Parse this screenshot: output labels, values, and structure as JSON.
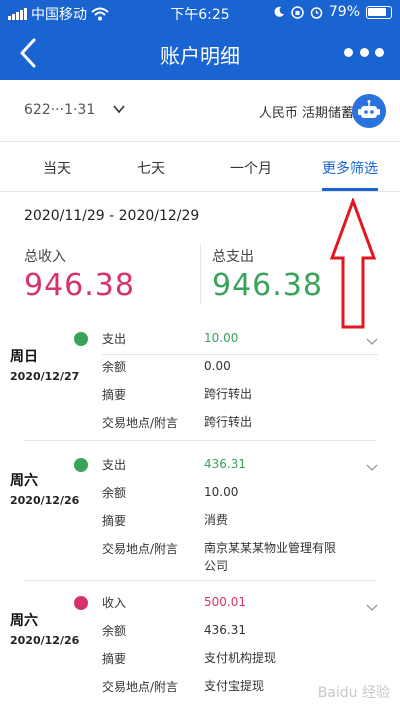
{
  "status": {
    "carrier": "中国移动",
    "time": "下午6:25",
    "battery": "79%"
  },
  "nav": {
    "title": "账户明细"
  },
  "account": {
    "number": "622···1·31",
    "currency": "人民币 活期储蓄"
  },
  "tabs": [
    {
      "label": "当天"
    },
    {
      "label": "七天"
    },
    {
      "label": "一个月"
    },
    {
      "label": "更多筛选"
    }
  ],
  "range": "2020/11/29 - 2020/12/29",
  "summary": {
    "income_label": "总收入",
    "income_value": "946.38",
    "expense_label": "总支出",
    "expense_value": "946.38"
  },
  "transactions": [
    {
      "day": "周日",
      "date": "2020/12/27",
      "type": "支出",
      "amount": "10.00",
      "balance_label": "余额",
      "balance": "0.00",
      "summary_label": "摘要",
      "summary": "跨行转出",
      "place_label": "交易地点/附言",
      "place": "跨行转出"
    },
    {
      "day": "周六",
      "date": "2020/12/26",
      "type": "支出",
      "amount": "436.31",
      "balance_label": "余额",
      "balance": "10.00",
      "summary_label": "摘要",
      "summary": "消费",
      "place_label": "交易地点/附言",
      "place": "南京某某某物业管理有限公司"
    },
    {
      "day": "周六",
      "date": "2020/12/26",
      "type": "收入",
      "amount": "500.01",
      "balance_label": "余额",
      "balance": "436.31",
      "summary_label": "摘要",
      "summary": "支付机构提现",
      "place_label": "交易地点/附言",
      "place": "支付宝提现"
    }
  ],
  "watermark": "Baidu 经验",
  "colors": {
    "brand": "#1a64d1",
    "income": "#d6336c",
    "expense": "#3aa35a"
  }
}
